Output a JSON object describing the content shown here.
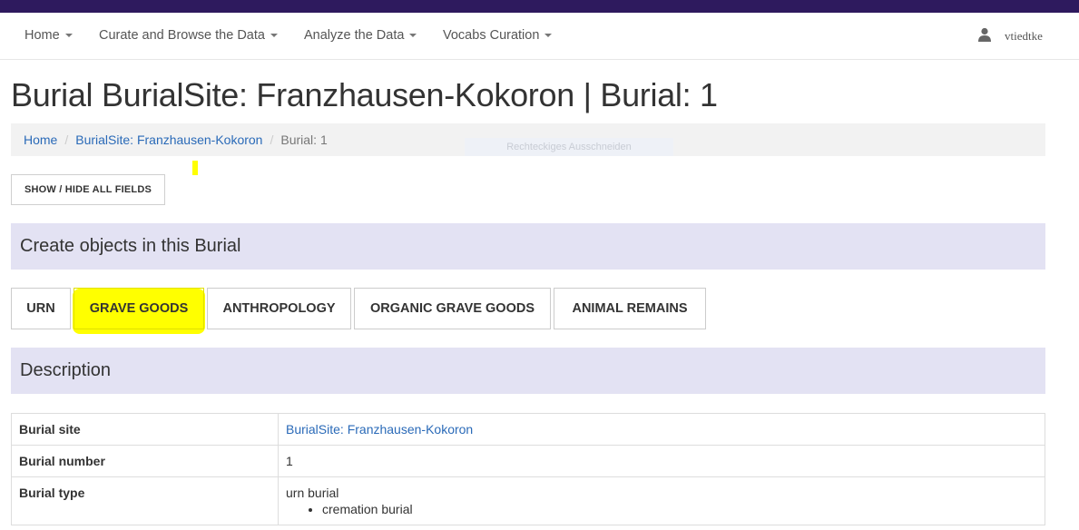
{
  "colors": {
    "topbar": "#2e1a5e",
    "panel": "#e3e2f3",
    "link": "#2a6ab8",
    "highlight": "#ffff00"
  },
  "nav": {
    "items": [
      {
        "label": "Home"
      },
      {
        "label": "Curate and Browse the Data"
      },
      {
        "label": "Analyze the Data"
      },
      {
        "label": "Vocabs Curation"
      }
    ],
    "user": {
      "icon": "user-icon",
      "name": "vtiedtke"
    }
  },
  "page": {
    "title": "Burial BurialSite: Franzhausen-Kokoron | Burial: 1"
  },
  "breadcrumb": [
    {
      "label": "Home"
    },
    {
      "label": "BurialSite: Franzhausen-Kokoron"
    },
    {
      "label": "Burial: 1"
    }
  ],
  "tooltip_ghost": "Rechteckiges Ausschneiden",
  "show_hide_button": "SHOW / HIDE ALL FIELDS",
  "create_panel": {
    "heading": "Create objects in this Burial",
    "buttons": [
      {
        "label": "URN"
      },
      {
        "label": "GRAVE GOODS",
        "highlighted": true
      },
      {
        "label": "ANTHROPOLOGY"
      },
      {
        "label": "ORGANIC GRAVE GOODS"
      },
      {
        "label": "ANIMAL REMAINS"
      }
    ]
  },
  "description": {
    "heading": "Description",
    "rows": [
      {
        "key": "Burial site",
        "value": "BurialSite: Franzhausen-Kokoron"
      },
      {
        "key": "Burial number",
        "value": "1"
      },
      {
        "key": "Burial type",
        "value": "urn burial",
        "list": [
          "cremation burial"
        ]
      }
    ]
  }
}
